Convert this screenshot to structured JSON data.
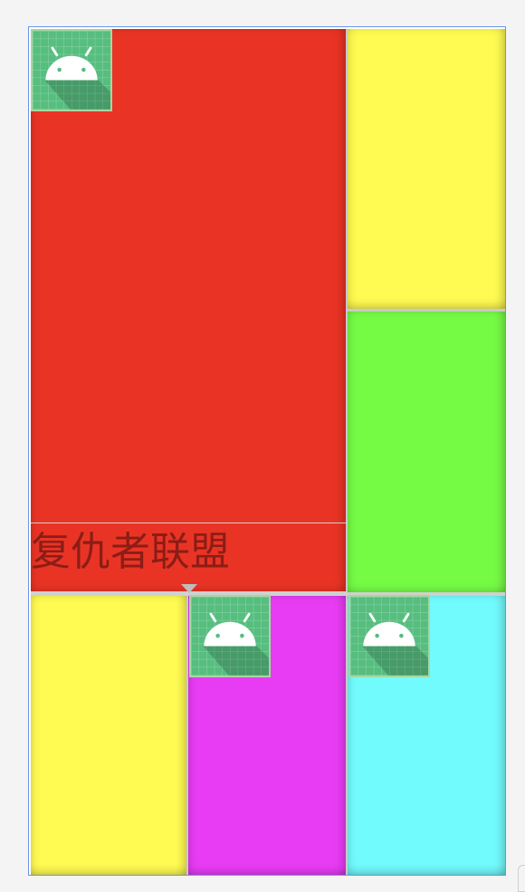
{
  "screen": {
    "title": "复仇者联盟"
  },
  "colors": {
    "red": "#e93425",
    "yellow": "#fffb52",
    "green": "#76fb45",
    "magenta": "#e83cf4",
    "cyan": "#72fbfd",
    "selection_border": "#6b95e8",
    "title_text": "#8b1d16"
  },
  "icons": {
    "placeholder": "android-launcher-icon",
    "collapse": "caret-down-icon"
  }
}
